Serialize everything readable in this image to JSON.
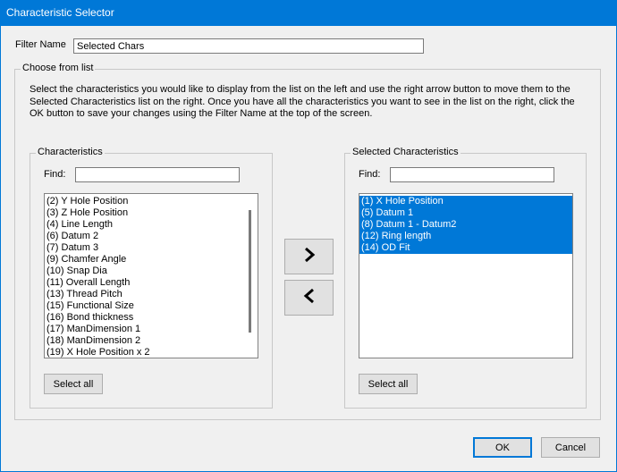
{
  "window": {
    "title": "Characteristic Selector"
  },
  "filter": {
    "label": "Filter Name",
    "value": "Selected Chars"
  },
  "choose_group": {
    "legend": "Choose from list",
    "description": "Select the characteristics you would like to display from the list on the left and use the right arrow button to move them to the Selected Characteristics list on the right. Once you have all the characteristics you want to see in the list on the right, click the OK button to save your changes using the Filter Name at the top of the screen."
  },
  "characteristics": {
    "legend": "Characteristics",
    "find_label": "Find:",
    "find_value": "",
    "items": [
      "(2) Y Hole Position",
      "(3) Z Hole Position",
      "(4) Line Length",
      "(6) Datum 2",
      "(7) Datum 3",
      "(9) Chamfer Angle",
      "(10) Snap Dia",
      "(11) Overall Length",
      "(13) Thread Pitch",
      "(15) Functional Size",
      "(16) Bond thickness",
      "(17) ManDimension 1",
      "(18) ManDimension 2",
      "(19) X Hole Position x 2"
    ],
    "select_all_label": "Select all"
  },
  "selected": {
    "legend": "Selected Characteristics",
    "find_label": "Find:",
    "find_value": "",
    "items": [
      "(1) X Hole Position",
      "(5) Datum 1",
      "(8) Datum 1 - Datum2",
      "(12) Ring length",
      "(14) OD Fit"
    ],
    "select_all_label": "Select all"
  },
  "move_buttons": {
    "right_icon": "chevron-right-icon",
    "left_icon": "chevron-left-icon"
  },
  "footer": {
    "ok_label": "OK",
    "cancel_label": "Cancel"
  },
  "colors": {
    "titlebar": "#0078d7",
    "selection": "#0078d7",
    "background": "#f0f0f0"
  }
}
